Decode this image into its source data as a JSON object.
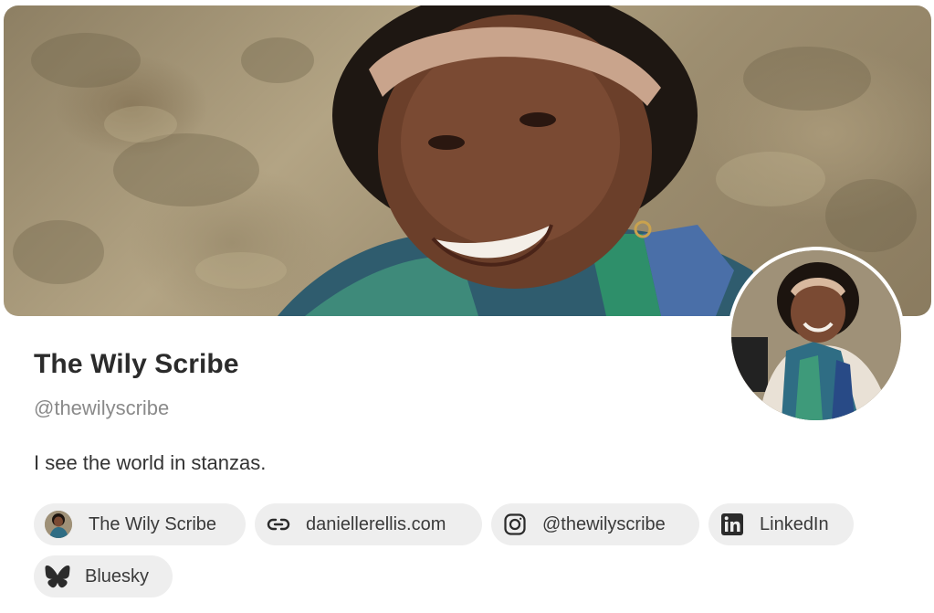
{
  "profile": {
    "display_name": "The Wily Scribe",
    "handle": "@thewilyscribe",
    "bio": "I see the world in stanzas."
  },
  "links": [
    {
      "label": "The Wily Scribe",
      "icon": "profile-avatar-icon"
    },
    {
      "label": "daniellerellis.com",
      "icon": "link-icon"
    },
    {
      "label": "@thewilyscribe",
      "icon": "instagram-icon"
    },
    {
      "label": "LinkedIn",
      "icon": "linkedin-icon"
    },
    {
      "label": "Bluesky",
      "icon": "bluesky-icon"
    }
  ],
  "colors": {
    "chip_background": "#eeeeee",
    "text_primary": "#2b2b2b",
    "text_muted": "#8a8a8a"
  }
}
